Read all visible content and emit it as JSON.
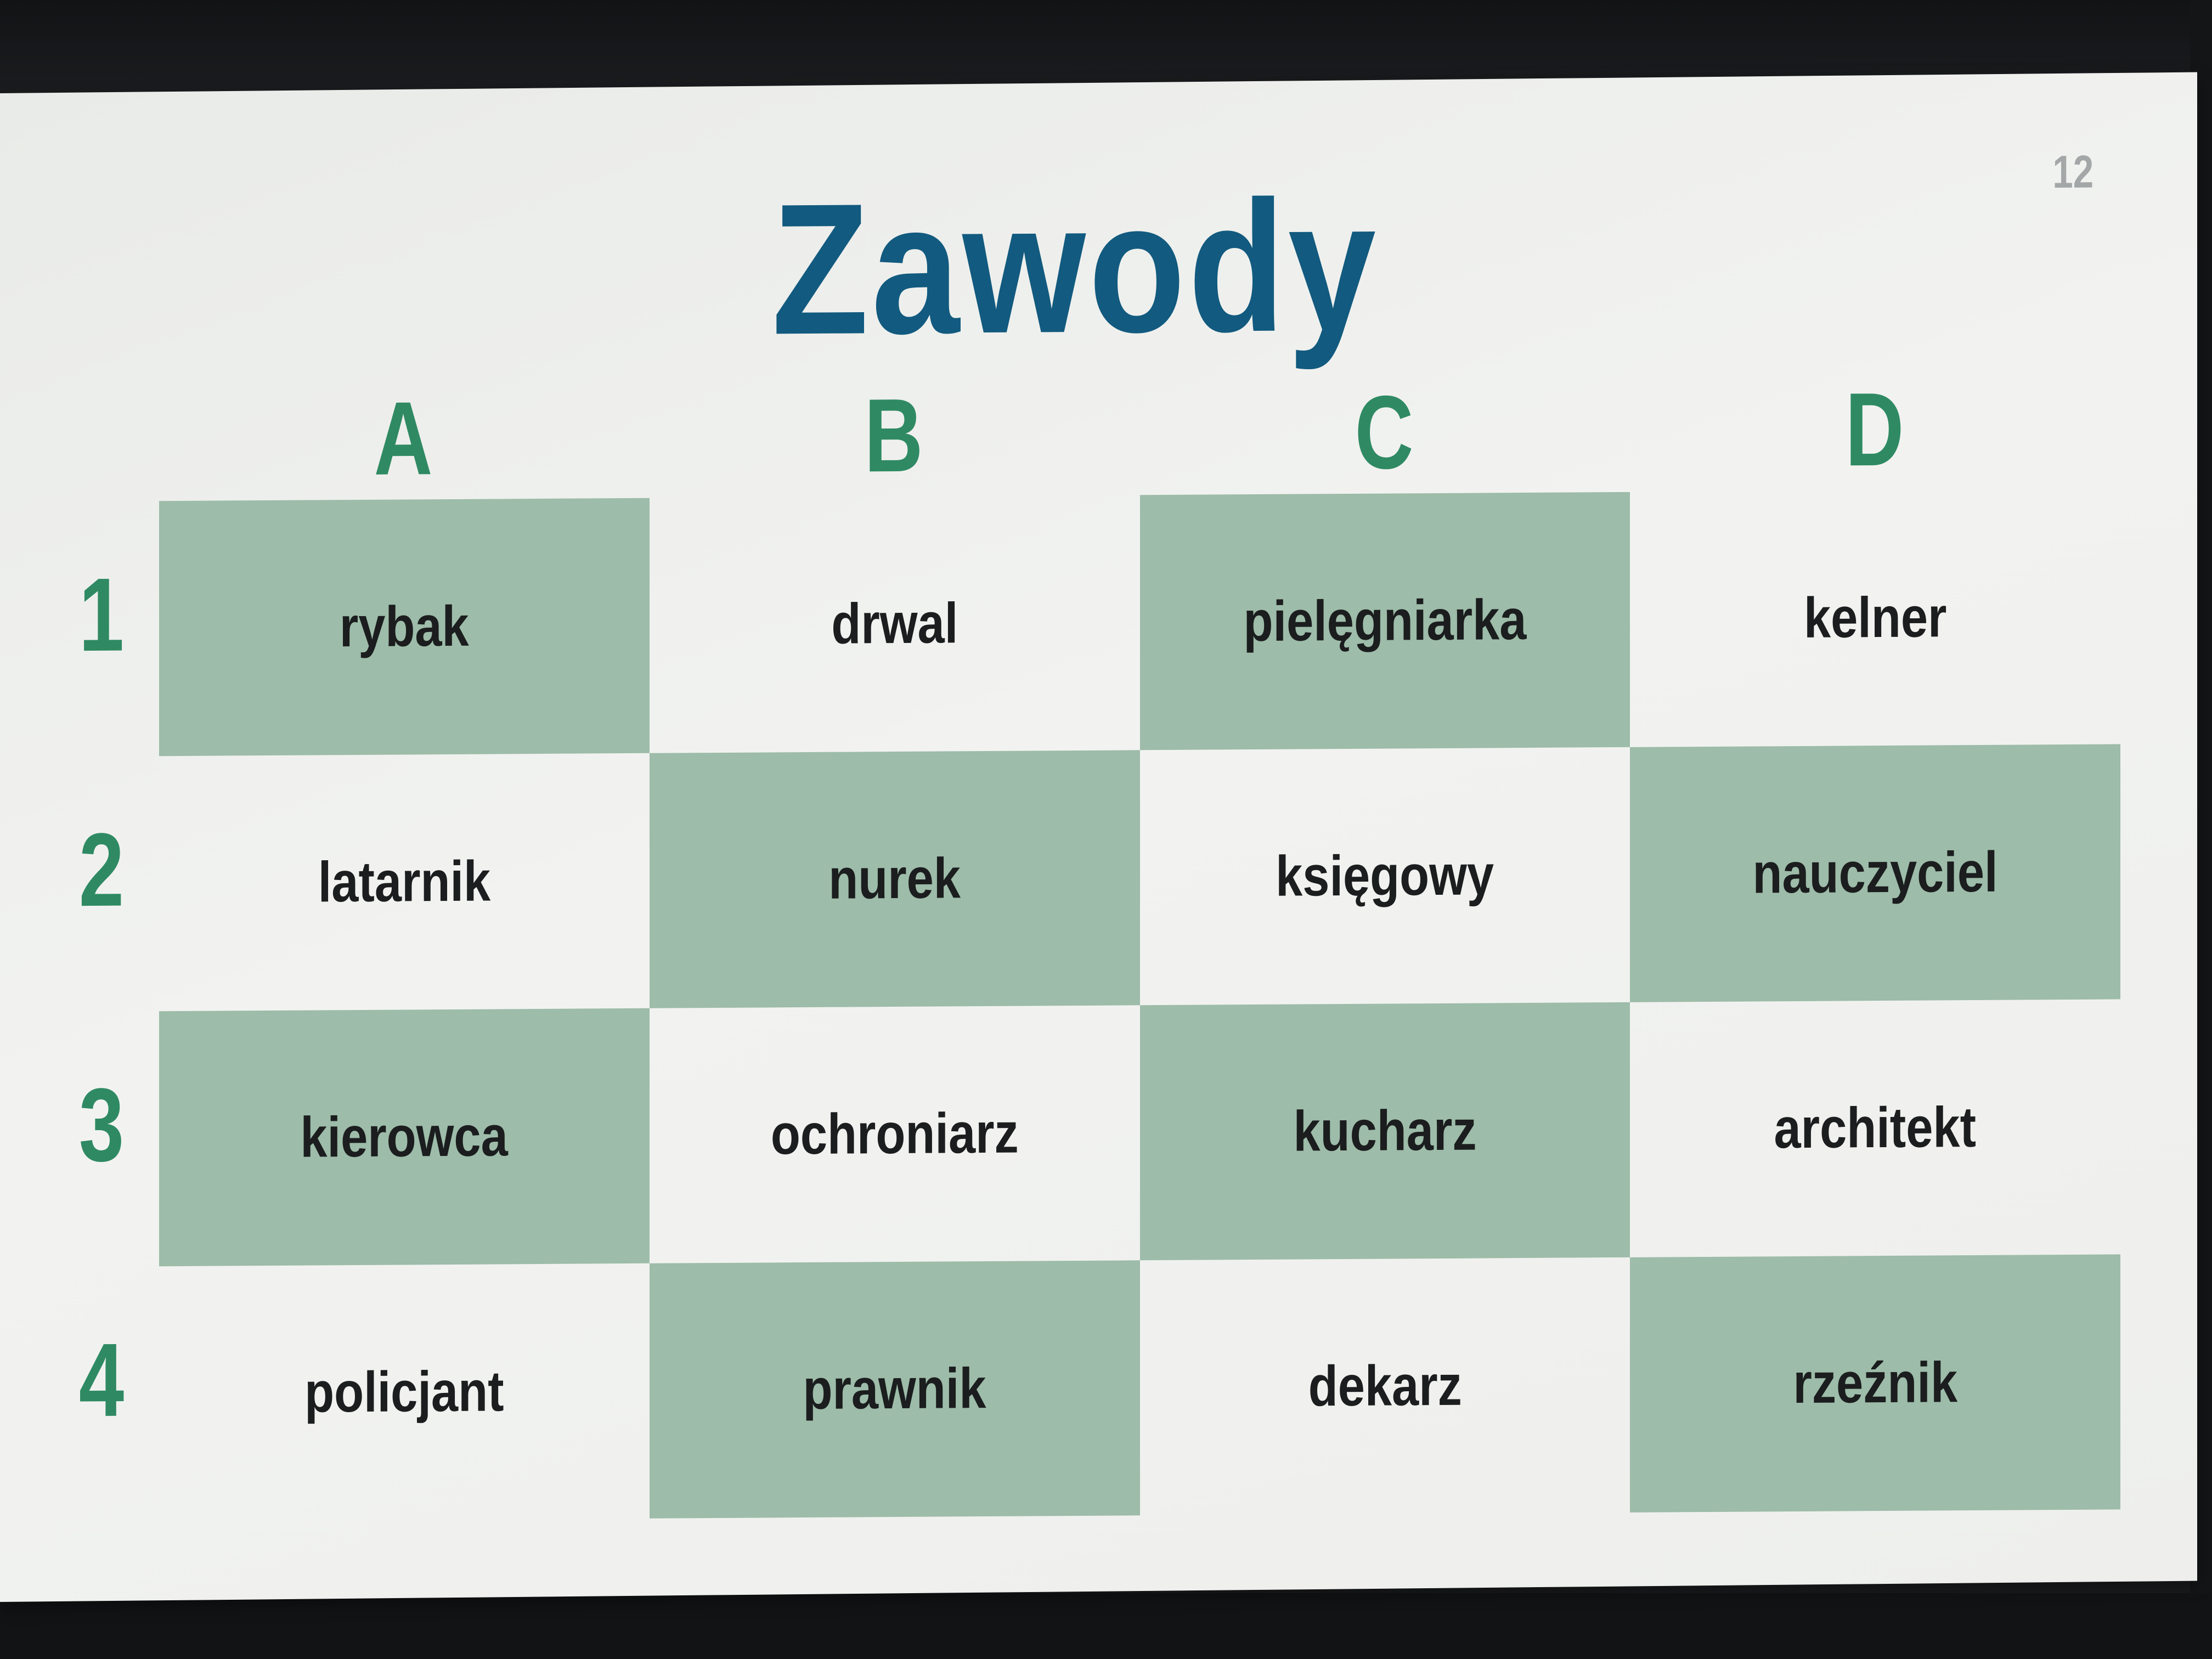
{
  "page_number": "12",
  "title": "Zawody",
  "columns": [
    "A",
    "B",
    "C",
    "D"
  ],
  "rows": [
    "1",
    "2",
    "3",
    "4"
  ],
  "colors": {
    "title": "#125a7f",
    "headers": "#2f8a63",
    "cell_fill": "#9dbca9",
    "card": "#f0f1ef"
  },
  "cells": [
    [
      {
        "text": "rybak",
        "filled": true
      },
      {
        "text": "drwal",
        "filled": false
      },
      {
        "text": "pielęgniarka",
        "filled": true
      },
      {
        "text": "kelner",
        "filled": false
      }
    ],
    [
      {
        "text": "latarnik",
        "filled": false
      },
      {
        "text": "nurek",
        "filled": true
      },
      {
        "text": "księgowy",
        "filled": false
      },
      {
        "text": "nauczyciel",
        "filled": true
      }
    ],
    [
      {
        "text": "kierowca",
        "filled": true
      },
      {
        "text": "ochroniarz",
        "filled": false
      },
      {
        "text": "kucharz",
        "filled": true
      },
      {
        "text": "architekt",
        "filled": false
      }
    ],
    [
      {
        "text": "policjant",
        "filled": false
      },
      {
        "text": "prawnik",
        "filled": true
      },
      {
        "text": "dekarz",
        "filled": false
      },
      {
        "text": "rzeźnik",
        "filled": true
      }
    ]
  ]
}
